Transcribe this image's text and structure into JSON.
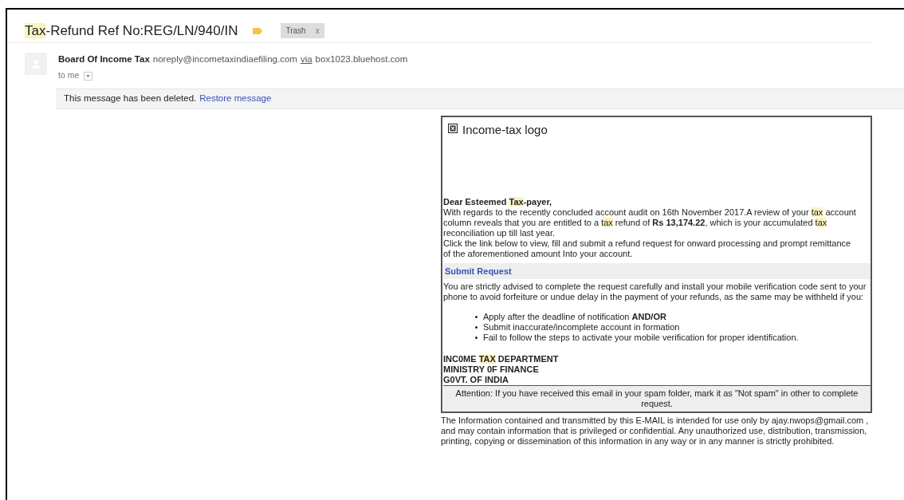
{
  "subject": [
    {
      "text": "Tax",
      "highlight": true
    },
    {
      "text": "-Refund Ref No:REG/LN/940/IN",
      "highlight": false
    }
  ],
  "label": {
    "text": "Trash",
    "close": "x"
  },
  "sender": {
    "name": "Board Of Income Tax",
    "email": "noreply@incometaxindiaefiling.com",
    "via": "via",
    "relay": "box1023.bluehost.com",
    "recipient": "to me"
  },
  "deleted_notice": {
    "text": "This message has been deleted.",
    "link": "Restore message"
  },
  "body": {
    "logo_alt": "Income-tax logo",
    "greeting": [
      {
        "text": "Dear Esteemed ",
        "highlight": false
      },
      {
        "text": "Tax",
        "highlight": true
      },
      {
        "text": "-payer,",
        "highlight": false
      }
    ],
    "paragraphs": [
      [
        {
          "text": "With regards to the recently concluded account audit on 16th November 2017.A review of your ",
          "highlight": false
        },
        {
          "text": "tax",
          "highlight": true
        },
        {
          "text": " account column reveals that you are entitled to a ",
          "highlight": false
        },
        {
          "text": "tax",
          "highlight": true
        },
        {
          "text": " refund of **Rs 13,174.22**, which is your accumulated ",
          "highlight": false
        },
        {
          "text": "tax",
          "highlight": true
        },
        {
          "text": " reconciliation up till last year.",
          "highlight": false
        }
      ],
      [
        {
          "text": "Click the link below to view, fill and submit a refund request for onward processing and prompt remittance of the aforementioned amount  Into your account.",
          "highlight": false
        }
      ]
    ],
    "link": "Submit Request",
    "advice": "You are strictly advised to complete the request carefully and install your mobile verification code sent to your phone to avoid forfeiture or undue delay in the payment of your refunds, as the same may be withheld if you:",
    "bullets": [
      "Apply after the deadline of notification **AND/OR**",
      "Submit inaccurate/incomplete account in formation",
      "Fail to follow the steps to activate your mobile verification for proper identification."
    ],
    "signature": [
      [
        {
          "text": "INC0ME ",
          "highlight": false
        },
        {
          "text": "TAX",
          "highlight": true
        },
        {
          "text": " DEPARTMENT",
          "highlight": false
        }
      ],
      [
        {
          "text": "MINISTRY 0F FINANCE",
          "highlight": false
        }
      ],
      [
        {
          "text": "G0VT. OF INDIA",
          "highlight": false
        }
      ]
    ],
    "attention": "Attention: If you have received this email in your spam folder, mark it as \"Not spam\" in other to complete request."
  },
  "footer": "The Information contained and transmitted by this E-MAIL is intended for use only by ajay.nwops@gmail.com , and may contain information that is privileged or confidential. Any unauthorized use, distribution, transmission, printing, copying or dissemination of this information in any way or in any manner is strictly prohibited."
}
